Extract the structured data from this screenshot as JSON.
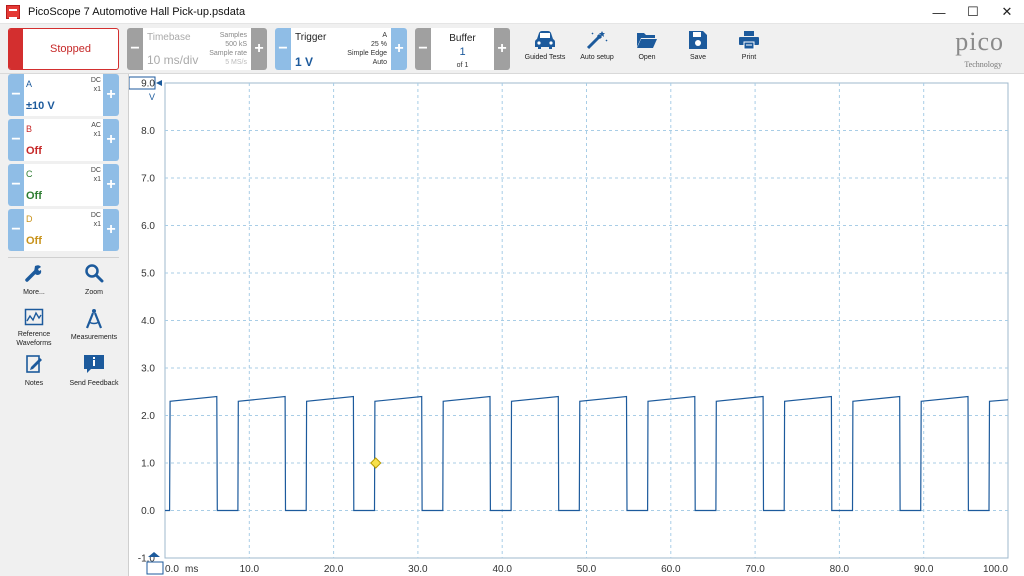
{
  "window": {
    "title": "PicoScope 7 Automotive Hall Pick-up.psdata",
    "minimize": "—",
    "maximize": "☐",
    "close": "✕"
  },
  "toolbar": {
    "run_state": "Stopped",
    "timebase": {
      "title": "Timebase",
      "value": "10 ms/div",
      "samples_label": "Samples",
      "samples_value": "500 kS",
      "rate_label": "Sample rate",
      "rate_value": "5 MS/s"
    },
    "trigger": {
      "title": "Trigger",
      "level": "1 V",
      "source": "A",
      "percent": "25 %",
      "type": "Simple Edge",
      "mode": "Auto"
    },
    "buffer": {
      "title": "Buffer",
      "current": "1",
      "total": "of 1"
    },
    "tools": [
      {
        "label": "Guided Tests",
        "icon": "car-icon"
      },
      {
        "label": "Auto setup",
        "icon": "magic-wand-icon"
      },
      {
        "label": "Open",
        "icon": "folder-icon"
      },
      {
        "label": "Save",
        "icon": "floppy-disk-icon"
      },
      {
        "label": "Print",
        "icon": "printer-icon"
      }
    ],
    "logo": {
      "word": "pico",
      "sub": "Technology"
    }
  },
  "channels": [
    {
      "name": "A",
      "coupling": "DC",
      "probe": "x1",
      "range": "±10 V",
      "color": "#1c5a9c"
    },
    {
      "name": "B",
      "coupling": "AC",
      "probe": "x1",
      "range": "Off",
      "color": "#c62828"
    },
    {
      "name": "C",
      "coupling": "DC",
      "probe": "x1",
      "range": "Off",
      "color": "#2e7d32"
    },
    {
      "name": "D",
      "coupling": "DC",
      "probe": "x1",
      "range": "Off",
      "color": "#c8921a"
    }
  ],
  "side_tools": [
    {
      "label": "More...",
      "icon": "wrench-icon"
    },
    {
      "label": "Zoom",
      "icon": "magnifier-icon"
    },
    {
      "label": "Reference Waveforms",
      "icon": "reference-waveforms-icon"
    },
    {
      "label": "Measurements",
      "icon": "compass-icon"
    },
    {
      "label": "Notes",
      "icon": "notes-icon"
    },
    {
      "label": "Send Feedback",
      "icon": "feedback-icon"
    }
  ],
  "colors": {
    "accent": "#1c5a9c",
    "stop": "#d32f2f",
    "button_blue": "#8fbde6",
    "button_gray": "#a0a0a0"
  },
  "chart_data": {
    "type": "line",
    "xlabel": "ms",
    "ylabel": "V",
    "xlim": [
      0,
      100
    ],
    "ylim": [
      -1.0,
      9.0
    ],
    "x_ticks": [
      "0.0",
      "10.0",
      "20.0",
      "30.0",
      "40.0",
      "50.0",
      "60.0",
      "70.0",
      "80.0",
      "90.0",
      "100.0"
    ],
    "y_ticks": [
      "9.0",
      "8.0",
      "7.0",
      "6.0",
      "5.0",
      "4.0",
      "3.0",
      "2.0",
      "1.0",
      "0.0",
      "-1.0"
    ],
    "grid": true,
    "trigger_marker": {
      "x": 25.0,
      "y": 1.0
    },
    "series": [
      {
        "channel": "A",
        "period_ms": 8.1,
        "high_v": 2.3,
        "high_end_v": 2.4,
        "low_v": 0.0,
        "high_ms": 5.6,
        "first_edge_ms": 0.55,
        "points": [
          [
            0.0,
            0.0
          ],
          [
            0.55,
            0.0
          ],
          [
            0.6,
            2.3
          ],
          [
            6.15,
            2.4
          ],
          [
            6.2,
            0.0
          ],
          [
            8.65,
            0.0
          ],
          [
            8.7,
            2.3
          ],
          [
            14.25,
            2.4
          ],
          [
            14.3,
            0.0
          ],
          [
            16.75,
            0.0
          ],
          [
            16.8,
            2.3
          ],
          [
            22.35,
            2.4
          ],
          [
            22.4,
            0.0
          ],
          [
            24.85,
            0.0
          ],
          [
            24.9,
            2.3
          ],
          [
            30.45,
            2.4
          ],
          [
            30.5,
            0.0
          ],
          [
            32.95,
            0.0
          ],
          [
            33.0,
            2.3
          ],
          [
            38.55,
            2.4
          ],
          [
            38.6,
            0.0
          ],
          [
            41.05,
            0.0
          ],
          [
            41.1,
            2.3
          ],
          [
            46.65,
            2.4
          ],
          [
            46.7,
            0.0
          ],
          [
            49.15,
            0.0
          ],
          [
            49.2,
            2.3
          ],
          [
            54.75,
            2.4
          ],
          [
            54.8,
            0.0
          ],
          [
            57.25,
            0.0
          ],
          [
            57.3,
            2.3
          ],
          [
            62.85,
            2.4
          ],
          [
            62.9,
            0.0
          ],
          [
            65.35,
            0.0
          ],
          [
            65.4,
            2.3
          ],
          [
            70.95,
            2.4
          ],
          [
            71.0,
            0.0
          ],
          [
            73.45,
            0.0
          ],
          [
            73.5,
            2.3
          ],
          [
            79.05,
            2.4
          ],
          [
            79.1,
            0.0
          ],
          [
            81.55,
            0.0
          ],
          [
            81.6,
            2.3
          ],
          [
            87.15,
            2.4
          ],
          [
            87.2,
            0.0
          ],
          [
            89.65,
            0.0
          ],
          [
            89.7,
            2.3
          ],
          [
            95.25,
            2.4
          ],
          [
            95.3,
            0.0
          ],
          [
            97.75,
            0.0
          ],
          [
            97.8,
            2.3
          ],
          [
            100.0,
            2.33
          ]
        ]
      }
    ]
  }
}
